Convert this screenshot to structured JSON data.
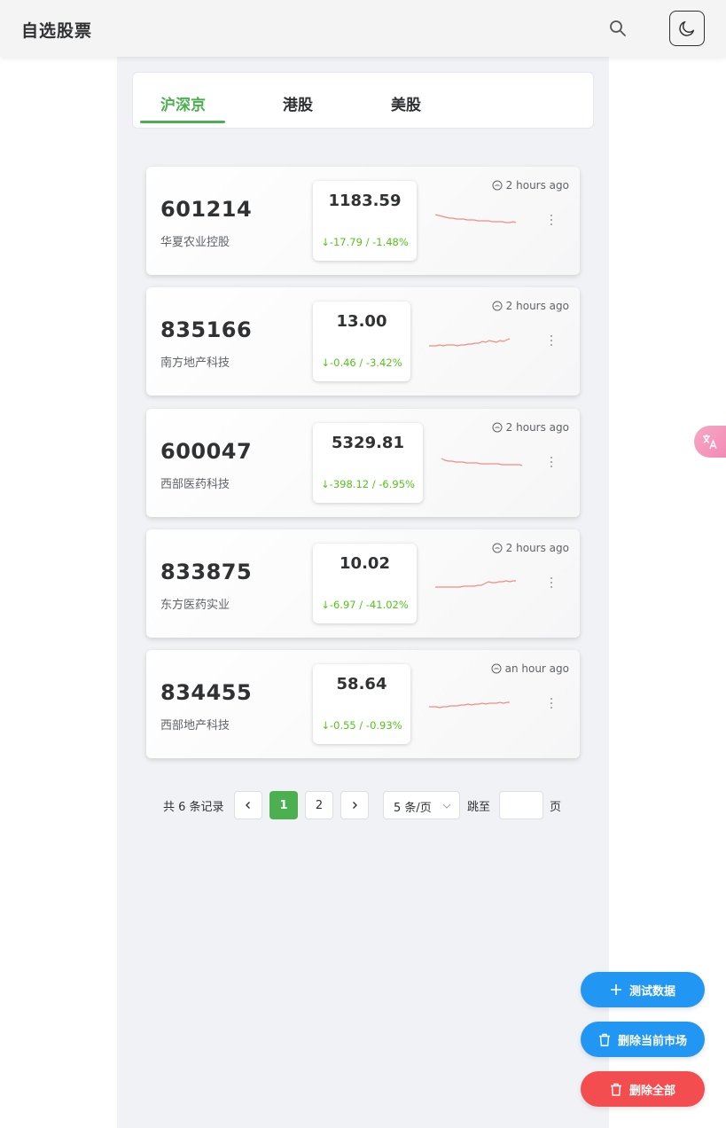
{
  "header": {
    "title": "自选股票"
  },
  "tabs": [
    {
      "label": "沪深京",
      "active": true
    },
    {
      "label": "港股",
      "active": false
    },
    {
      "label": "美股",
      "active": false
    }
  ],
  "stocks": [
    {
      "code": "601214",
      "name": "华夏农业控股",
      "price": "1183.59",
      "change": "↓-17.79 / -1.48%",
      "time": "2 hours ago",
      "trend": "down"
    },
    {
      "code": "835166",
      "name": "南方地产科技",
      "price": "13.00",
      "change": "↓-0.46 / -3.42%",
      "time": "2 hours ago",
      "trend": "up"
    },
    {
      "code": "600047",
      "name": "西部医药科技",
      "price": "5329.81",
      "change": "↓-398.12 / -6.95%",
      "time": "2 hours ago",
      "trend": "down"
    },
    {
      "code": "833875",
      "name": "东方医药实业",
      "price": "10.02",
      "change": "↓-6.97 / -41.02%",
      "time": "2 hours ago",
      "trend": "up"
    },
    {
      "code": "834455",
      "name": "西部地产科技",
      "price": "58.64",
      "change": "↓-0.55 / -0.93%",
      "time": "an hour ago",
      "trend": "up"
    }
  ],
  "pagination": {
    "total_text": "共 6 条记录",
    "pages": [
      "1",
      "2"
    ],
    "current_page": "1",
    "page_size": "5 条/页",
    "jump_label": "跳至",
    "page_suffix": "页"
  },
  "actions": {
    "add_test_data": "测试数据",
    "delete_market": "删除当前市场",
    "delete_all": "删除全部"
  },
  "colors": {
    "accent_green": "#4caf50",
    "change_green": "#52c41a",
    "sparkline": "#f28b82",
    "button_blue": "#2196f3",
    "button_red": "#f44d4f"
  },
  "icons": {
    "search": "search-icon",
    "theme": "moon-icon",
    "time": "clock-icon",
    "more": "more-vertical-icon",
    "prev": "chevron-left-icon",
    "next": "chevron-right-icon",
    "select": "chevron-down-icon",
    "add": "plus-icon",
    "delete": "trash-icon",
    "translate": "translate-icon"
  }
}
